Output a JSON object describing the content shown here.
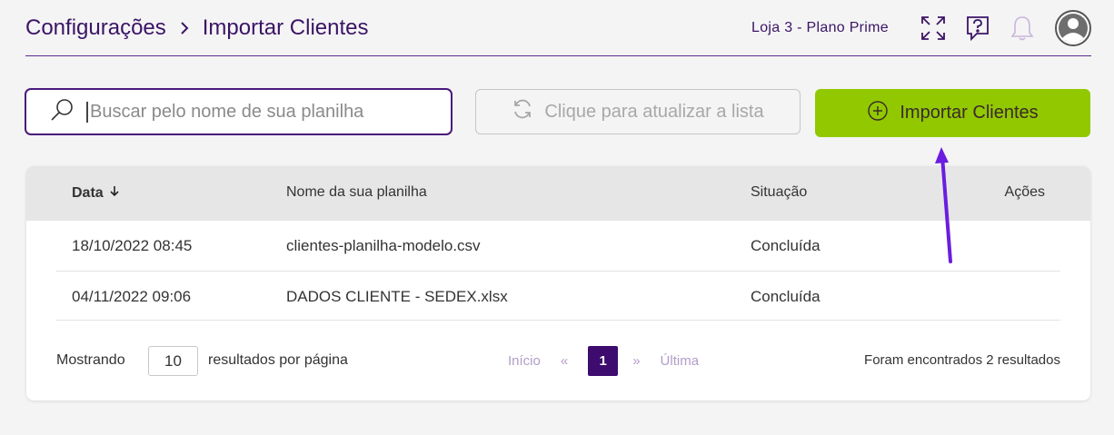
{
  "header": {
    "breadcrumb": [
      "Configurações",
      "Importar Clientes"
    ],
    "store_label": "Loja 3 - Plano Prime"
  },
  "toolbar": {
    "search_placeholder": "Buscar pelo nome de sua planilha",
    "refresh_label": "Clique para atualizar a lista",
    "import_label": "Importar Clientes"
  },
  "table": {
    "columns": {
      "date": "Data",
      "name": "Nome da sua planilha",
      "status": "Situação",
      "actions": "Ações"
    },
    "rows": [
      {
        "date": "18/10/2022 08:45",
        "name": "clientes-planilha-modelo.csv",
        "status": "Concluída"
      },
      {
        "date": "04/11/2022 09:06",
        "name": "DADOS CLIENTE - SEDEX.xlsx",
        "status": "Concluída"
      }
    ]
  },
  "footer": {
    "showing_label": "Mostrando",
    "per_page_value": "10",
    "per_page_label": "resultados por página",
    "pager": {
      "first": "Início",
      "prev": "«",
      "current": "1",
      "next": "»",
      "last": "Última"
    },
    "results_text": "Foram encontrados 2 resultados"
  },
  "colors": {
    "brand_purple": "#3d0c6e",
    "accent_green": "#92c800",
    "annotation_arrow": "#6a1de0"
  },
  "icons": {
    "expand": "expand-icon",
    "help": "help-chat-icon",
    "bell": "bell-icon",
    "avatar": "user-avatar-icon",
    "search": "search-icon",
    "refresh": "refresh-icon",
    "add": "plus-circle-icon",
    "sort": "arrow-down-icon"
  }
}
